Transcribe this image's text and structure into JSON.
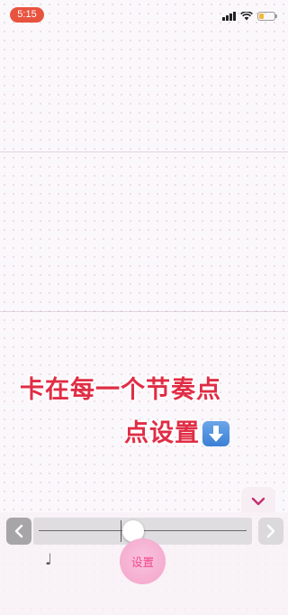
{
  "status_bar": {
    "time": "5:15",
    "icons": [
      "cellular-signal-icon",
      "wifi-icon",
      "battery-icon"
    ],
    "battery_level": 0.3,
    "time_pill_color": "#e8533f"
  },
  "caption": {
    "line1": "卡在每一个节奏点",
    "line2": "点设置",
    "emoji": "down-arrow-icon",
    "color": "#e02d45"
  },
  "editor": {
    "collapse_icon": "chevron-down-icon",
    "prev_icon": "chevron-left-icon",
    "next_icon": "chevron-right-icon",
    "note_icon": "♩",
    "set_button_label": "设置",
    "accent_color": "#f0488e"
  }
}
